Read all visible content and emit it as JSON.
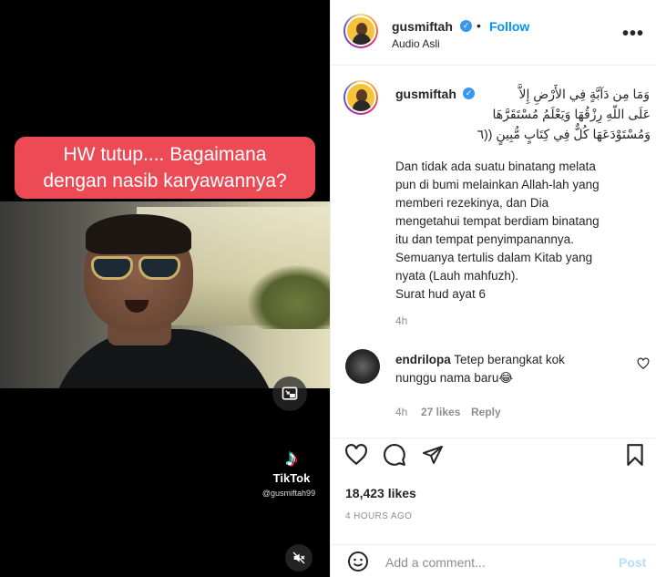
{
  "media": {
    "caption_line1": "HW tutup.... Bagaimana",
    "caption_line2": "dengan nasib karyawannya?",
    "tiktok_logo": "♪",
    "tiktok_word": "TikTok",
    "tiktok_handle": "@gusmiftah99"
  },
  "header": {
    "username": "gusmiftah",
    "verified": "✓",
    "dot": "•",
    "follow_label": "Follow",
    "audio": "Audio Asli",
    "more": "•••"
  },
  "post": {
    "username": "gusmiftah",
    "verified": "✓",
    "arabic_line1": "وَمَا مِن دَآبَّةٍ فِي الأَرْضِ إِلاَّ",
    "arabic_line2": "عَلَى اللّهِ رِزْقُهَا وَيَعْلَمُ مُسْتَقَرَّهَا",
    "arabic_line3": "وَمُسْتَوْدَعَهَا كُلٌّ فِي كِتَابٍ مُّبِينٍ ((٦",
    "caption": [
      "Dan tidak ada suatu binatang melata",
      "pun di bumi melainkan Allah-lah yang",
      "memberi rezekinya, dan Dia",
      "mengetahui tempat berdiam binatang",
      "itu dan tempat penyimpanannya.",
      "Semuanya tertulis dalam Kitab yang",
      "nyata (Lauh mahfuzh).",
      "Surat hud ayat 6"
    ],
    "age": "4h"
  },
  "comment": {
    "username": "endrilopa",
    "text_line1": "Tetep berangkat kok",
    "text_line2": "nunggu nama baru😂",
    "age": "4h",
    "likes": "27 likes",
    "reply": "Reply"
  },
  "actions": {
    "likes": "18,423 likes",
    "timestamp": "4 HOURS AGO"
  },
  "add_comment": {
    "placeholder": "Add a comment...",
    "post_label": "Post",
    "emoji_icon": "smiley-icon"
  },
  "colors": {
    "accent": "#0095f6",
    "caption_bg": "#ec4b55",
    "muted": "#8e8e8e"
  }
}
